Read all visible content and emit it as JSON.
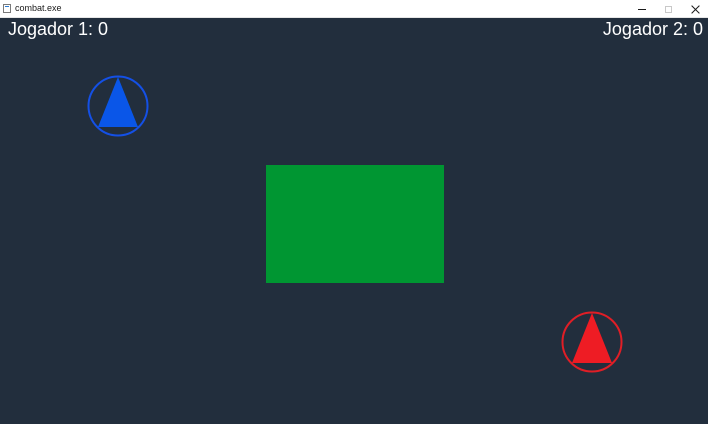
{
  "window": {
    "title": "combat.exe",
    "icons": {
      "app": "app-window-icon",
      "minimize": "minimize-icon",
      "maximize": "maximize-icon",
      "close": "close-icon"
    }
  },
  "game": {
    "background_color": "#222e3d",
    "scoreboard": {
      "player1_label": "Jogador 1: 0",
      "player2_label": "Jogador 2: 0"
    },
    "obstacle": {
      "color": "#009632"
    },
    "players": [
      {
        "name": "player-1-tank",
        "color": "#0a56e8",
        "ring_color": "#1450e6"
      },
      {
        "name": "player-2-tank",
        "color": "#ee1c24",
        "ring_color": "#e01e26"
      }
    ]
  }
}
